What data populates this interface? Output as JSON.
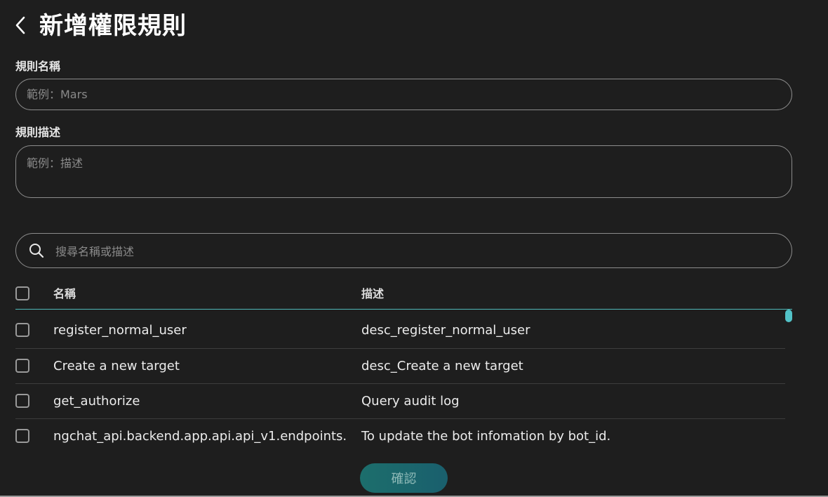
{
  "header": {
    "title": "新增權限規則",
    "back_icon": "chevron-left-icon"
  },
  "form": {
    "name_label": "規則名稱",
    "name_placeholder": "範例：Mars",
    "name_value": "",
    "desc_label": "規則描述",
    "desc_placeholder": "範例：描述",
    "desc_value": ""
  },
  "search": {
    "icon": "search-icon",
    "placeholder": "搜尋名稱或描述",
    "value": ""
  },
  "table": {
    "columns": [
      "名稱",
      "描述"
    ],
    "rows": [
      {
        "name": "register_normal_user",
        "description": "desc_register_normal_user",
        "checked": false
      },
      {
        "name": "Create a new target",
        "description": "desc_Create a new target",
        "checked": false
      },
      {
        "name": "get_authorize",
        "description": "Query audit log",
        "checked": false
      },
      {
        "name": "ngchat_api.backend.app.api.api_v1.endpoints.",
        "description": "To update the bot infomation by bot_id.",
        "checked": false
      }
    ]
  },
  "actions": {
    "confirm_label": "確認"
  },
  "colors": {
    "background": "#1e1e1e",
    "accent": "#4fb8b8",
    "scrollbar": "#52c2c7",
    "confirm_button": "#1c6e6c"
  }
}
